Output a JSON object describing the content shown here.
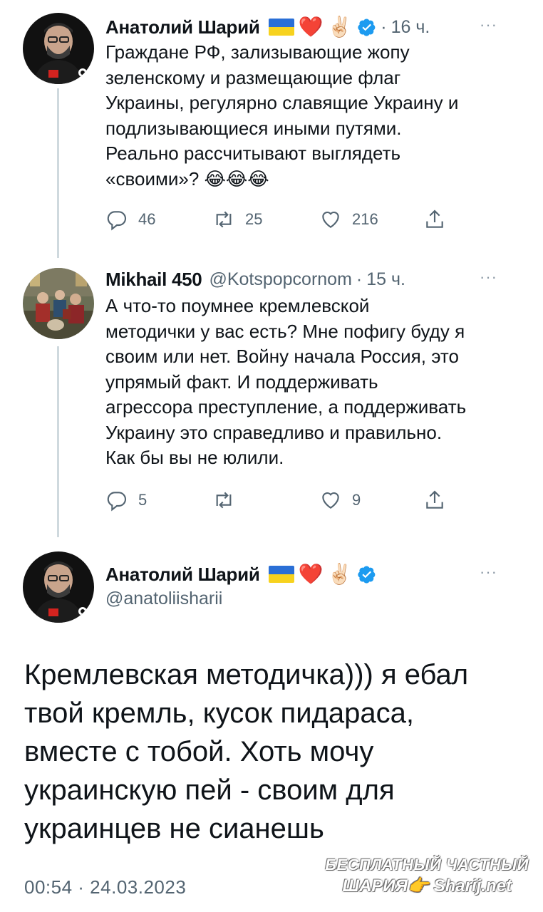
{
  "tweets": [
    {
      "name": "Анатолий Шарий",
      "emojis": [
        "❤️",
        "✌🏻"
      ],
      "time": "16 ч.",
      "more": "···",
      "lines": [
        "Граждане РФ, зализывающие жопу",
        "зеленскому и размещающие флаг",
        "Украины, регулярно славящие Украину и",
        "подлизывающиеся иными путями.",
        "Реально рассчитывают выглядеть",
        "«своими»? 😂😂😂"
      ],
      "replies": "46",
      "retweets": "25",
      "likes": "216"
    },
    {
      "name": "Mikhail 450",
      "handle": "@Kotspopcornom",
      "time": "15 ч.",
      "more": "···",
      "lines": [
        "А что-то поумнее кремлевской",
        "методички у вас есть? Мне пофигу буду я",
        "своим или нет. Войну начала Россия, это",
        "упрямый факт. И поддерживать",
        "агрессора преступление, а поддерживать",
        "Украину это справедливо и правильно.",
        "Как бы вы не юлили."
      ],
      "replies": "5",
      "retweets": "",
      "likes": "9"
    },
    {
      "name": "Анатолий Шарий",
      "emojis": [
        "❤️",
        "✌🏻"
      ],
      "handle": "@anatoliisharii",
      "more": "···",
      "lines": [
        "Кремлевская методичка))) я ебал",
        "твой кремль, кусок пидараса,",
        "вместе с тобой. Хоть мочу",
        "украинскую пей - своим для",
        "украинцев не сианешь"
      ],
      "timestamp": "00:54 · 24.03.2023"
    }
  ],
  "watermark": {
    "line1": "БЕСПЛАТНЫЙ ЧАСТНЫЙ",
    "line2": "ШАРИЯ👉 Sharij.net"
  },
  "colors": {
    "text": "#0f1419",
    "secondary": "#536471",
    "verified": "#1d9bf0",
    "thread_line": "#cfd9de"
  },
  "icons": [
    "reply-icon",
    "retweet-icon",
    "like-icon",
    "share-icon",
    "verified-badge-icon",
    "ukraine-flag-icon"
  ]
}
